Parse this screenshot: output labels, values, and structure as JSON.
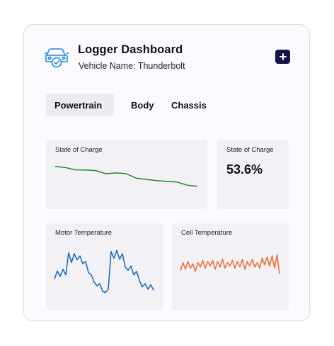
{
  "header": {
    "title": "Logger Dashboard",
    "vehicle_label": "Vehicle Name: Thunderbolt",
    "logo_icon": "car-check-icon",
    "add_button_icon": "plus-icon",
    "accent_color": "#14144a"
  },
  "tabs": [
    {
      "label": "Powertrain",
      "active": true
    },
    {
      "label": "Body",
      "active": false
    },
    {
      "label": "Chassis",
      "active": false
    }
  ],
  "tiles": {
    "soc_chart": {
      "title": "State of Charge",
      "color": "#1f8b24",
      "values": [
        95,
        92,
        86,
        85.5,
        84,
        76,
        78,
        76,
        64,
        61,
        58,
        56,
        54,
        46,
        43
      ]
    },
    "soc_metric": {
      "title": "State of Charge",
      "value": "53.6%"
    },
    "motor_temp": {
      "title": "Motor Temperature",
      "color": "#1565c0",
      "values": [
        40,
        55,
        45,
        58,
        48,
        88,
        70,
        86,
        75,
        82,
        68,
        72,
        52,
        48,
        35,
        28,
        32,
        18,
        16,
        22,
        90,
        78,
        92,
        76,
        86,
        62,
        56,
        64,
        48,
        54,
        38,
        26,
        32,
        22,
        30,
        20
      ]
    },
    "cell_temp": {
      "title": "Cell Temperature",
      "color": "#f06a32",
      "values": [
        55,
        70,
        58,
        72,
        60,
        68,
        54,
        70,
        62,
        74,
        60,
        72,
        64,
        74,
        58,
        72,
        62,
        76,
        60,
        70,
        64,
        74,
        60,
        72,
        62,
        76,
        58,
        72,
        64,
        76,
        62,
        70,
        60,
        78,
        66,
        80,
        64,
        82,
        60,
        84,
        50
      ]
    }
  }
}
